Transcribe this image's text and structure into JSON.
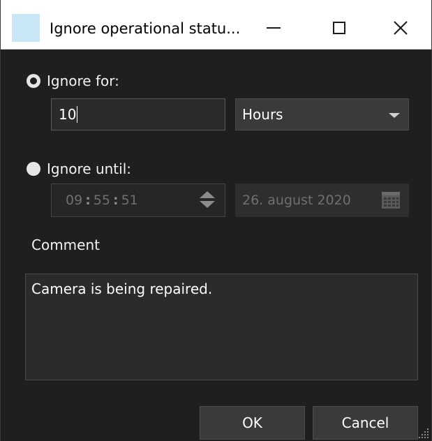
{
  "window": {
    "title": "Ignore operational statu...",
    "colors": {
      "background": "#1f1f1f",
      "titlebar": "#ffffff",
      "app_icon": "#c8e6f5"
    }
  },
  "ignore_for": {
    "label": "Ignore for:",
    "selected": true,
    "value": "10",
    "unit": "Hours"
  },
  "ignore_until": {
    "label": "Ignore until:",
    "selected": false,
    "time": {
      "hours": "09",
      "minutes": "55",
      "seconds": "51",
      "separator": ":"
    },
    "date": "26. august 2020"
  },
  "comment": {
    "label": "Comment",
    "value": "Camera is being repaired."
  },
  "buttons": {
    "ok": "OK",
    "cancel": "Cancel"
  },
  "icons": {
    "app": "app-icon",
    "minimize": "minimize-icon",
    "maximize": "maximize-icon",
    "close": "close-icon",
    "dropdown": "chevron-down-icon",
    "spinner": "spinner-icon",
    "calendar": "calendar-icon",
    "resize": "resize-grip-icon"
  }
}
